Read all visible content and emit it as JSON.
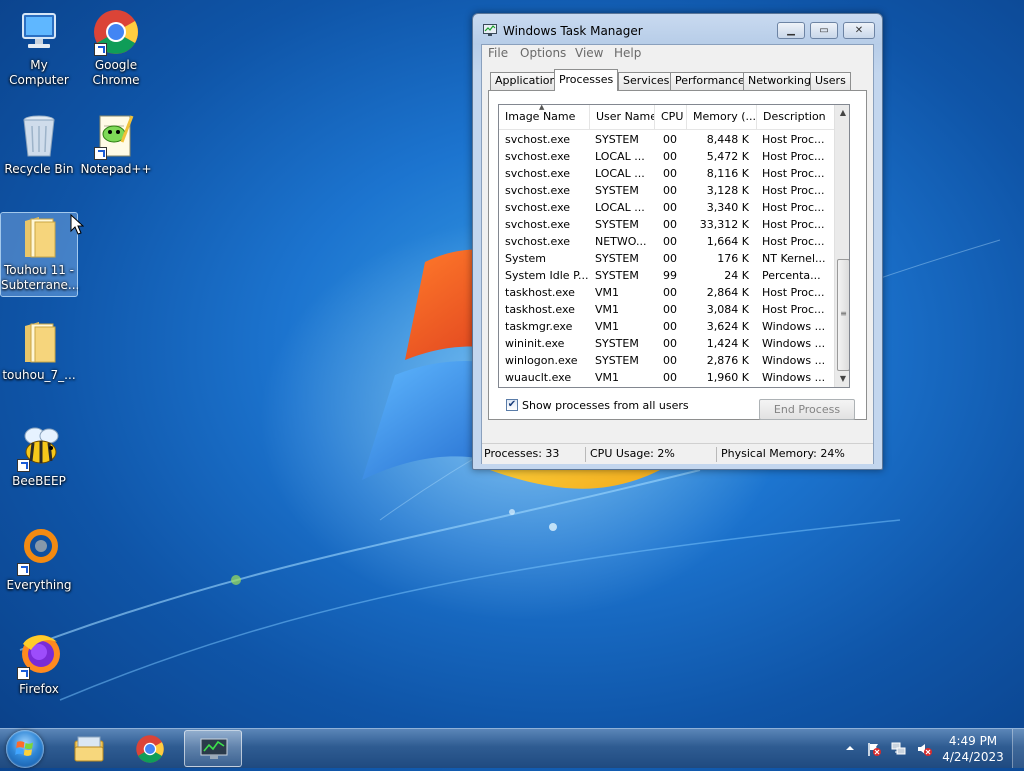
{
  "desktop": {
    "icons": [
      {
        "label": "My Computer"
      },
      {
        "label": "Google Chrome"
      },
      {
        "label": "Recycle Bin"
      },
      {
        "label": "Notepad++"
      },
      {
        "label": "Touhou 11 - Subterrane..."
      },
      {
        "label": "touhou_7_..."
      },
      {
        "label": "BeeBEEP"
      },
      {
        "label": "Everything"
      },
      {
        "label": "Firefox"
      }
    ]
  },
  "window": {
    "title": "Windows Task Manager",
    "menu": [
      "File",
      "Options",
      "View",
      "Help"
    ],
    "tabs": [
      "Applications",
      "Processes",
      "Services",
      "Performance",
      "Networking",
      "Users"
    ],
    "active_tab": "Processes",
    "columns": [
      "Image Name",
      "User Name",
      "CPU",
      "Memory (...",
      "Description"
    ],
    "rows": [
      {
        "name": "svchost.exe",
        "user": "SYSTEM",
        "cpu": "00",
        "mem": "8,448 K",
        "desc": "Host Proc..."
      },
      {
        "name": "svchost.exe",
        "user": "LOCAL ...",
        "cpu": "00",
        "mem": "5,472 K",
        "desc": "Host Proc..."
      },
      {
        "name": "svchost.exe",
        "user": "LOCAL ...",
        "cpu": "00",
        "mem": "8,116 K",
        "desc": "Host Proc..."
      },
      {
        "name": "svchost.exe",
        "user": "SYSTEM",
        "cpu": "00",
        "mem": "3,128 K",
        "desc": "Host Proc..."
      },
      {
        "name": "svchost.exe",
        "user": "LOCAL ...",
        "cpu": "00",
        "mem": "3,340 K",
        "desc": "Host Proc..."
      },
      {
        "name": "svchost.exe",
        "user": "SYSTEM",
        "cpu": "00",
        "mem": "33,312 K",
        "desc": "Host Proc..."
      },
      {
        "name": "svchost.exe",
        "user": "NETWO...",
        "cpu": "00",
        "mem": "1,664 K",
        "desc": "Host Proc..."
      },
      {
        "name": "System",
        "user": "SYSTEM",
        "cpu": "00",
        "mem": "176 K",
        "desc": "NT Kernel..."
      },
      {
        "name": "System Idle P...",
        "user": "SYSTEM",
        "cpu": "99",
        "mem": "24 K",
        "desc": "Percenta..."
      },
      {
        "name": "taskhost.exe",
        "user": "VM1",
        "cpu": "00",
        "mem": "2,864 K",
        "desc": "Host Proc..."
      },
      {
        "name": "taskhost.exe",
        "user": "VM1",
        "cpu": "00",
        "mem": "3,084 K",
        "desc": "Host Proc..."
      },
      {
        "name": "taskmgr.exe",
        "user": "VM1",
        "cpu": "00",
        "mem": "3,624 K",
        "desc": "Windows ..."
      },
      {
        "name": "wininit.exe",
        "user": "SYSTEM",
        "cpu": "00",
        "mem": "1,424 K",
        "desc": "Windows ..."
      },
      {
        "name": "winlogon.exe",
        "user": "SYSTEM",
        "cpu": "00",
        "mem": "2,876 K",
        "desc": "Windows ..."
      },
      {
        "name": "wuauclt.exe",
        "user": "VM1",
        "cpu": "00",
        "mem": "1,960 K",
        "desc": "Windows ..."
      }
    ],
    "show_all_users": {
      "checked": true,
      "label": "Show processes from all users"
    },
    "end_process_label": "End Process",
    "status": {
      "processes": "Processes: 33",
      "cpu": "CPU Usage: 2%",
      "memory": "Physical Memory: 24%"
    }
  },
  "taskbar": {
    "time": "4:49 PM",
    "date": "4/24/2023",
    "pinned": [
      "start-button",
      "file-explorer",
      "google-chrome",
      "task-manager"
    ],
    "tray_icons": [
      "show-hidden-icons-arrow",
      "action-center-flag-icon",
      "network-icon",
      "volume-muted-icon"
    ]
  },
  "colors": {
    "accent": "#1c74cf",
    "taskbar": "#2f5c92",
    "selection": "#cde8ff"
  }
}
